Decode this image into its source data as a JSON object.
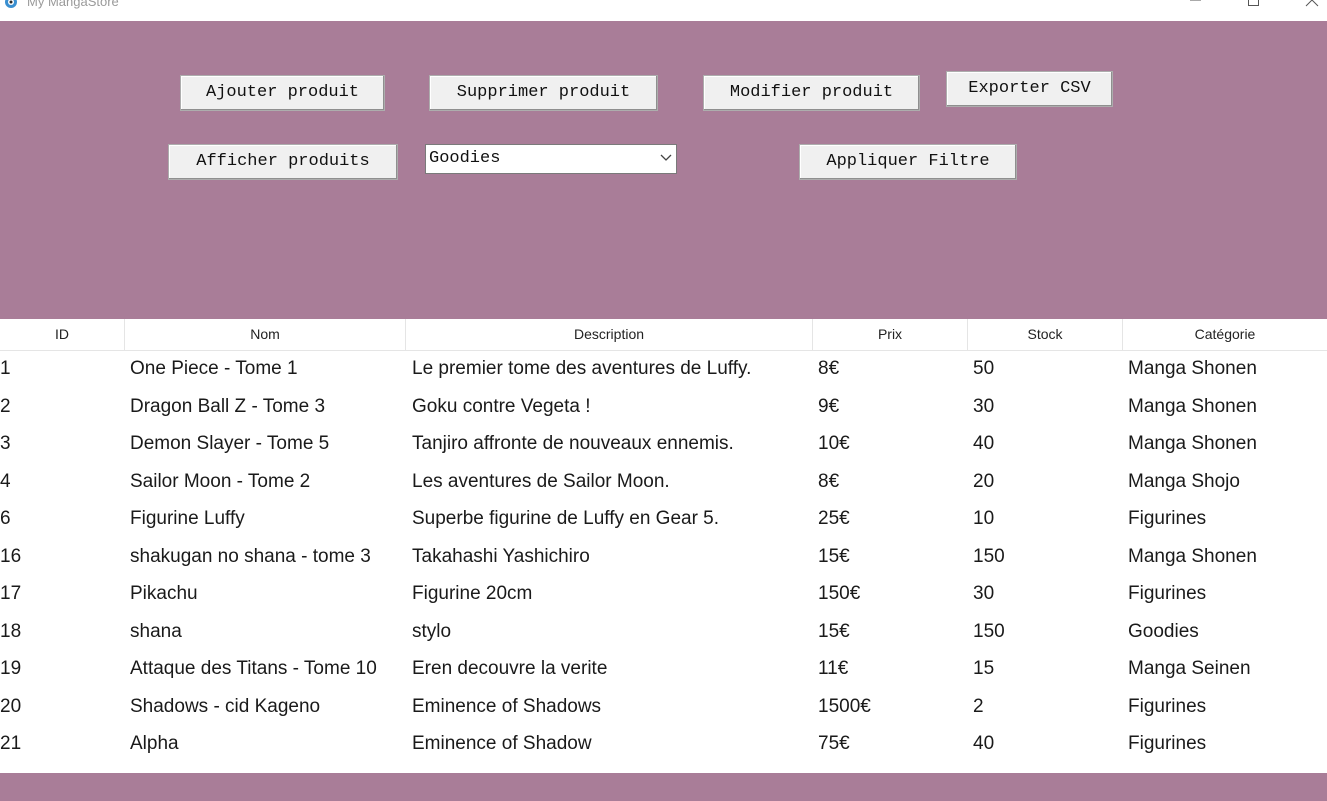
{
  "window": {
    "title": "My MangaStore",
    "app_icon": "gear-cat-icon",
    "controls": [
      "minimize-icon",
      "maximize-icon",
      "close-icon"
    ]
  },
  "theme": {
    "toolbar_bg": "#a97d98",
    "button_bg": "#f0f0f0",
    "table_bg": "#ffffff"
  },
  "toolbar": {
    "add_label": "Ajouter produit",
    "delete_label": "Supprimer produit",
    "modify_label": "Modifier produit",
    "export_label": "Exporter CSV",
    "show_label": "Afficher produits",
    "apply_label": "Appliquer Filtre",
    "filter": {
      "selected": "Goodies"
    }
  },
  "table": {
    "columns": [
      "ID",
      "Nom",
      "Description",
      "Prix",
      "Stock",
      "Catégorie"
    ],
    "rows": [
      [
        "1",
        "One Piece - Tome 1",
        "Le premier tome des aventures de Luffy.",
        "8€",
        "50",
        "Manga Shonen"
      ],
      [
        "2",
        "Dragon Ball Z - Tome 3",
        "Goku contre Vegeta !",
        "9€",
        "30",
        "Manga Shonen"
      ],
      [
        "3",
        "Demon Slayer - Tome 5",
        "Tanjiro affronte de nouveaux ennemis.",
        "10€",
        "40",
        "Manga Shonen"
      ],
      [
        "4",
        "Sailor Moon - Tome 2",
        "Les aventures de Sailor Moon.",
        "8€",
        "20",
        "Manga Shojo"
      ],
      [
        "6",
        "Figurine Luffy",
        "Superbe figurine de Luffy en Gear 5.",
        "25€",
        "10",
        "Figurines"
      ],
      [
        "16",
        "shakugan no shana - tome 3",
        "Takahashi Yashichiro",
        "15€",
        "150",
        "Manga Shonen"
      ],
      [
        "17",
        "Pikachu",
        "Figurine 20cm",
        "150€",
        "30",
        "Figurines"
      ],
      [
        "18",
        "shana",
        "stylo",
        "15€",
        "150",
        "Goodies"
      ],
      [
        "19",
        "Attaque des Titans - Tome 10",
        "Eren decouvre la verite",
        "11€",
        "15",
        "Manga Seinen"
      ],
      [
        "20",
        "Shadows - cid Kageno",
        "Eminence of Shadows",
        "1500€",
        "2",
        "Figurines"
      ],
      [
        "21",
        "Alpha",
        "Eminence of Shadow",
        "75€",
        "40",
        "Figurines"
      ]
    ]
  }
}
